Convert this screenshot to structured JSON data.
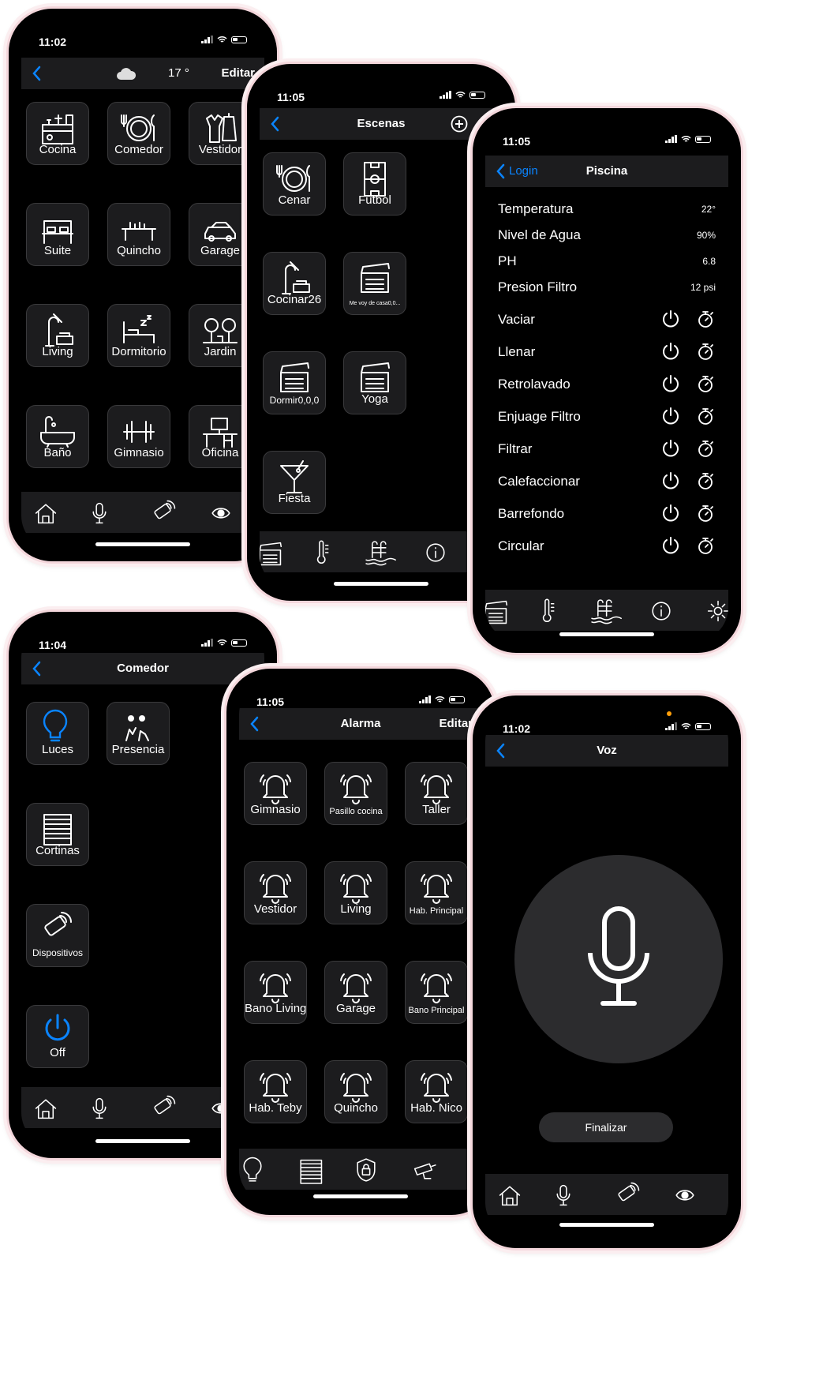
{
  "colors": {
    "accent": "#0a84ff",
    "tile_bg": "#1c1c1e",
    "bezel": "#f4d7dc"
  },
  "p1": {
    "time": "11:02",
    "temp": "17 °",
    "edit": "Editar",
    "rooms": [
      "Cocina",
      "Comedor",
      "Vestidor",
      "Suite",
      "Quincho",
      "Garage",
      "Living",
      "Dormitorio",
      "Jardin",
      "Baño",
      "Gimnasio",
      "Oficina"
    ]
  },
  "p2": {
    "time": "11:05",
    "title": "Escenas",
    "scenes": [
      "Cenar",
      "Futbol",
      "Cocinar26",
      "Me voy de casa0,0...",
      "Dormir0,0,0",
      "Yoga",
      "Fiesta"
    ]
  },
  "p3": {
    "time": "11:05",
    "back": "Login",
    "title": "Piscina",
    "readings": [
      {
        "label": "Temperatura",
        "value": "22°"
      },
      {
        "label": "Nivel de Agua",
        "value": "90%"
      },
      {
        "label": "PH",
        "value": "6.8"
      },
      {
        "label": "Presion Filtro",
        "value": "12 psi"
      }
    ],
    "controls": [
      "Vaciar",
      "Llenar",
      "Retrolavado",
      "Enjuage Filtro",
      "Filtrar",
      "Calefaccionar",
      "Barrefondo",
      "Circular"
    ]
  },
  "p4": {
    "time": "11:04",
    "title": "Comedor",
    "devices": [
      "Luces",
      "Presencia",
      "Cortinas",
      "Dispositivos",
      "Off"
    ]
  },
  "p5": {
    "time": "11:05",
    "title": "Alarma",
    "edit": "Editar",
    "zones": [
      "Gimnasio",
      "Pasillo cocina",
      "Taller",
      "Vestidor",
      "Living",
      "Hab. Principal",
      "Bano Living",
      "Garage",
      "Bano Principal",
      "Hab. Teby",
      "Quincho",
      "Hab. Nico"
    ]
  },
  "p6": {
    "time": "11:02",
    "title": "Voz",
    "finish": "Finalizar"
  }
}
